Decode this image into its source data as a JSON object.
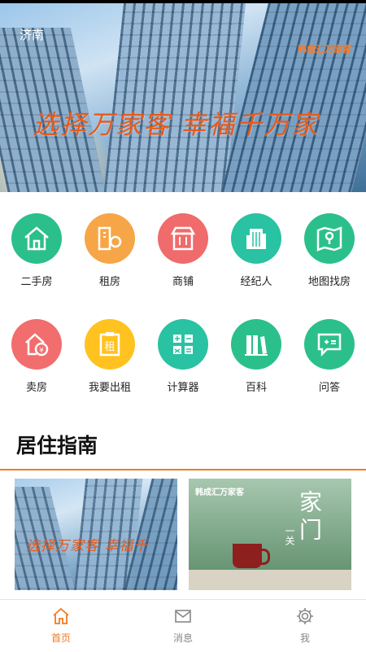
{
  "banner": {
    "city": "济南",
    "logo_text": "韩成汇万家客",
    "slogan": "选择万家客 幸福千万家"
  },
  "menu": [
    {
      "label": "二手房",
      "icon": "house-icon",
      "color": "#2bc08b"
    },
    {
      "label": "租房",
      "icon": "rent-key-icon",
      "color": "#f6a647"
    },
    {
      "label": "商铺",
      "icon": "shop-icon",
      "color": "#f06b6b"
    },
    {
      "label": "经纪人",
      "icon": "building-icon",
      "color": "#29c2a3"
    },
    {
      "label": "地图找房",
      "icon": "map-pin-icon",
      "color": "#2bc08b"
    },
    {
      "label": "卖房",
      "icon": "sell-house-icon",
      "color": "#f26d6d"
    },
    {
      "label": "我要出租",
      "icon": "rent-sign-icon",
      "color": "#ffc21f"
    },
    {
      "label": "计算器",
      "icon": "calculator-icon",
      "color": "#29c2a3"
    },
    {
      "label": "百科",
      "icon": "books-icon",
      "color": "#2bc08b"
    },
    {
      "label": "问答",
      "icon": "chat-icon",
      "color": "#2bc08b"
    }
  ],
  "guide": {
    "title": "居住指南",
    "card1": {
      "slogan": "选择万家客 幸福千"
    },
    "card2": {
      "logo_text": "韩成汇万家客",
      "title": "家门",
      "subtitle": "一关"
    }
  },
  "tabs": [
    {
      "label": "首页",
      "icon": "home-icon",
      "active": true
    },
    {
      "label": "消息",
      "icon": "mail-icon",
      "active": false
    },
    {
      "label": "我",
      "icon": "gear-icon",
      "active": false
    }
  ],
  "colors": {
    "accent": "#f07b22",
    "inactive_tab": "#888888"
  }
}
